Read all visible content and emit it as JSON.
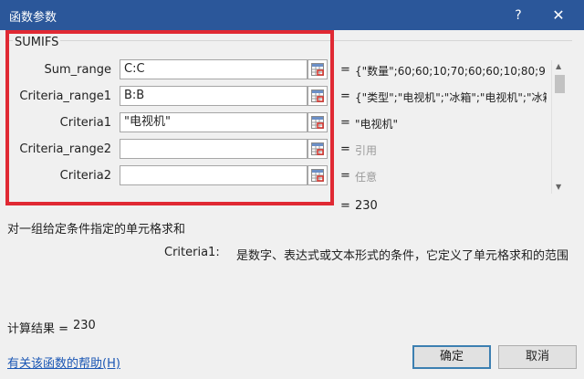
{
  "window": {
    "title": "函数参数",
    "help_symbol": "?",
    "close_symbol": "✕"
  },
  "function_name": "SUMIFS",
  "arguments": [
    {
      "label": "Sum_range",
      "value": "C:C",
      "eq": "=",
      "result": "{\"数量\";60;60;10;70;60;60;10;80;9..."
    },
    {
      "label": "Criteria_range1",
      "value": "B:B",
      "eq": "=",
      "result": "{\"类型\";\"电视机\";\"冰箱\";\"电视机\";\"冰箱"
    },
    {
      "label": "Criteria1",
      "value": "\"电视机\"",
      "eq": "=",
      "result": "\"电视机\""
    },
    {
      "label": "Criteria_range2",
      "value": "",
      "eq": "=",
      "result": "引用"
    },
    {
      "label": "Criteria2",
      "value": "",
      "eq": "=",
      "result": "任意"
    }
  ],
  "total": {
    "eq": "=",
    "value": "230"
  },
  "description": "对一组给定条件指定的单元格求和",
  "arg_help": {
    "name": "Criteria1:",
    "text": "是数字、表达式或文本形式的条件，它定义了单元格求和的范围"
  },
  "calc": {
    "label": "计算结果 =",
    "value": "230"
  },
  "help_link": "有关该函数的帮助(H)",
  "buttons": {
    "ok": "确定",
    "cancel": "取消"
  },
  "icons": {
    "ref": "range-select-icon",
    "scroll_up": "scroll-up-icon",
    "scroll_down": "scroll-down-icon"
  },
  "colors": {
    "titlebar": "#2b579a",
    "highlight": "#e02933"
  }
}
